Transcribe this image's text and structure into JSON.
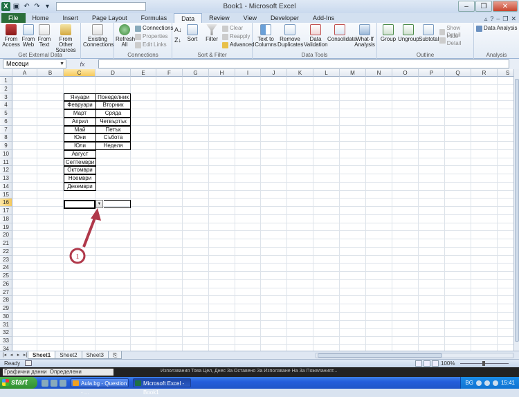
{
  "window": {
    "title": "Book1 - Microsoft Excel"
  },
  "ribbon_tabs": [
    "File",
    "Home",
    "Insert",
    "Page Layout",
    "Formulas",
    "Data",
    "Review",
    "View",
    "Developer",
    "Add-Ins"
  ],
  "active_tab": "Data",
  "ribbon": {
    "get_external_data": {
      "label": "Get External Data",
      "from_access": "From\nAccess",
      "from_web": "From\nWeb",
      "from_text": "From\nText",
      "from_other": "From Other\nSources"
    },
    "existing_connections": "Existing\nConnections",
    "connections": {
      "label": "Connections",
      "refresh_all": "Refresh\nAll",
      "connections": "Connections",
      "properties": "Properties",
      "edit_links": "Edit Links"
    },
    "sort_filter": {
      "label": "Sort & Filter",
      "sort": "Sort",
      "filter": "Filter",
      "clear": "Clear",
      "reapply": "Reapply",
      "advanced": "Advanced"
    },
    "data_tools": {
      "label": "Data Tools",
      "text_to_columns": "Text to\nColumns",
      "remove_duplicates": "Remove\nDuplicates",
      "data_validation": "Data\nValidation",
      "consolidate": "Consolidate",
      "what_if": "What-If\nAnalysis"
    },
    "outline": {
      "label": "Outline",
      "group": "Group",
      "ungroup": "Ungroup",
      "subtotal": "Subtotal",
      "show_detail": "Show Detail",
      "hide_detail": "Hide Detail"
    },
    "analysis": {
      "label": "Analysis",
      "data_analysis": "Data Analysis"
    }
  },
  "formula_bar": {
    "name_box": "Месеци",
    "fx": "fx",
    "formula": ""
  },
  "columns": [
    "A",
    "B",
    "C",
    "D",
    "E",
    "F",
    "G",
    "H",
    "I",
    "J",
    "K",
    "L",
    "M",
    "N",
    "O",
    "P",
    "Q",
    "R",
    "S"
  ],
  "selected_column": "C",
  "rows": [
    1,
    2,
    3,
    4,
    5,
    6,
    7,
    8,
    9,
    10,
    11,
    12,
    13,
    14,
    15,
    16,
    17,
    18,
    19,
    20,
    21,
    22,
    23,
    24,
    25,
    26,
    27,
    28,
    29,
    30,
    31,
    32,
    33,
    34
  ],
  "selected_row": 16,
  "months": [
    "Януари",
    "Февруари",
    "Март",
    "Април",
    "Май",
    "Юни",
    "Юли",
    "Август",
    "Септември",
    "Октомври",
    "Ноември",
    "Декември"
  ],
  "weekdays": [
    "Понеделник",
    "Вторник",
    "Сряда",
    "Четвъртък",
    "Петък",
    "Събота",
    "Неделя"
  ],
  "annotation": {
    "label": "1",
    "color": "#b0384a"
  },
  "sheets": [
    "Sheet1",
    "Sheet2",
    "Sheet3"
  ],
  "active_sheet": "Sheet1",
  "status": {
    "ready": "Ready",
    "zoom": "100%"
  },
  "strip": {
    "left_item": "Графични данни",
    "left_item2": "Определени",
    "right_text": "Използвания Това Цел, Днес За Оставено За Използване На За Пожеланият..."
  },
  "taskbar": {
    "start": "start",
    "items": [
      "Aula.bg - Question - ...",
      "Microsoft Excel - Book1"
    ],
    "active_item": 1,
    "lang": "BG",
    "clock": "15:41"
  }
}
